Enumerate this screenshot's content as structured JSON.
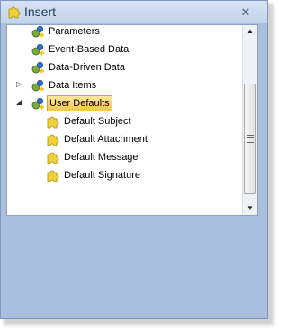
{
  "window": {
    "title": "Insert",
    "minimize_symbol": "—",
    "close_symbol": "✕",
    "accent": "#c3d3ea",
    "body_bg": "#a9bfdd"
  },
  "tree": {
    "items": [
      {
        "label": "Parameters",
        "icon": "gear-plus-icon"
      },
      {
        "label": "Event-Based Data",
        "icon": "gear-plus-icon"
      },
      {
        "label": "Data-Driven Data",
        "icon": "gear-plus-icon"
      },
      {
        "label": "Data Items",
        "icon": "gear-plus-icon",
        "expander": "▷"
      },
      {
        "label": "User Defaults",
        "icon": "gear-plus-icon",
        "expander": "◢",
        "selected": true
      },
      {
        "label": "Default Subject",
        "icon": "puzzle-icon"
      },
      {
        "label": "Default Attachment",
        "icon": "puzzle-icon"
      },
      {
        "label": "Default Message",
        "icon": "puzzle-icon"
      },
      {
        "label": "Default Signature",
        "icon": "puzzle-icon"
      }
    ]
  },
  "scrollbar": {
    "up_symbol": "▲",
    "down_symbol": "▼"
  }
}
